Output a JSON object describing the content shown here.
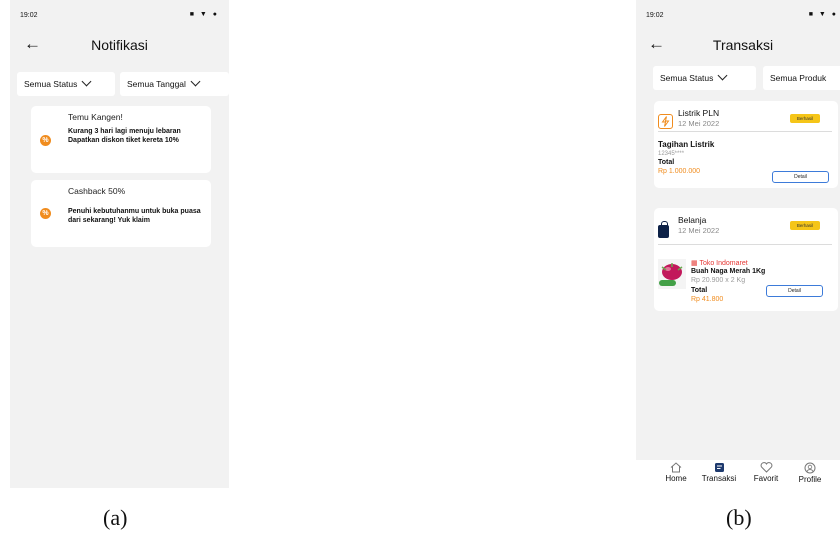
{
  "panel_a": {
    "status": {
      "time": "19:02",
      "icons": "■ ▼ ●"
    },
    "header": {
      "title": "Notifikasi"
    },
    "filters": {
      "status": "Semua Status",
      "date": "Semua Tanggal"
    },
    "notifications": [
      {
        "title": "Temu Kangen!",
        "body": "Kurang 3 hari lagi menuju lebaran Dapatkan diskon tiket kereta 10%",
        "icon": "discount-icon"
      },
      {
        "title": "Cashback 50%",
        "body": "Penuhi kebutuhanmu untuk buka puasa dari sekarang! Yuk klaim",
        "icon": "discount-icon"
      }
    ],
    "caption": "(a)"
  },
  "panel_b": {
    "status": {
      "time": "19:02",
      "icons": "■ ▼ ●"
    },
    "header": {
      "title": "Transaksi"
    },
    "filters": {
      "status": "Semua Status",
      "product": "Semua Produk"
    },
    "transactions": [
      {
        "name": "Listrik PLN",
        "date": "12 Mei 2022",
        "badge": "Berhasil",
        "item": "Tagihan Listrik",
        "account": "12345****",
        "total_label": "Total",
        "total": "Rp 1.000.000",
        "detail": "Detail",
        "icon": "bolt-icon"
      },
      {
        "name": "Belanja",
        "date": "12 Mei 2022",
        "badge": "Berhasil",
        "store": "Toko Indomaret",
        "product": "Buah Naga Merah 1Kg",
        "price_qty": "Rp 20.900 x 2 Kg",
        "total_label": "Total",
        "total": "Rp 41.800",
        "detail": "Detail",
        "icon": "shopping-bag-icon"
      }
    ],
    "nav": [
      {
        "label": "Home",
        "icon": "home-icon"
      },
      {
        "label": "Transaksi",
        "icon": "transaction-icon"
      },
      {
        "label": "Favorit",
        "icon": "heart-icon"
      },
      {
        "label": "Profile",
        "icon": "profile-icon"
      }
    ],
    "caption": "(b)"
  },
  "colors": {
    "accent": "#f08c1e",
    "badge": "#f5c518",
    "button_border": "#3d7bd9",
    "background": "#f2f2f2"
  }
}
